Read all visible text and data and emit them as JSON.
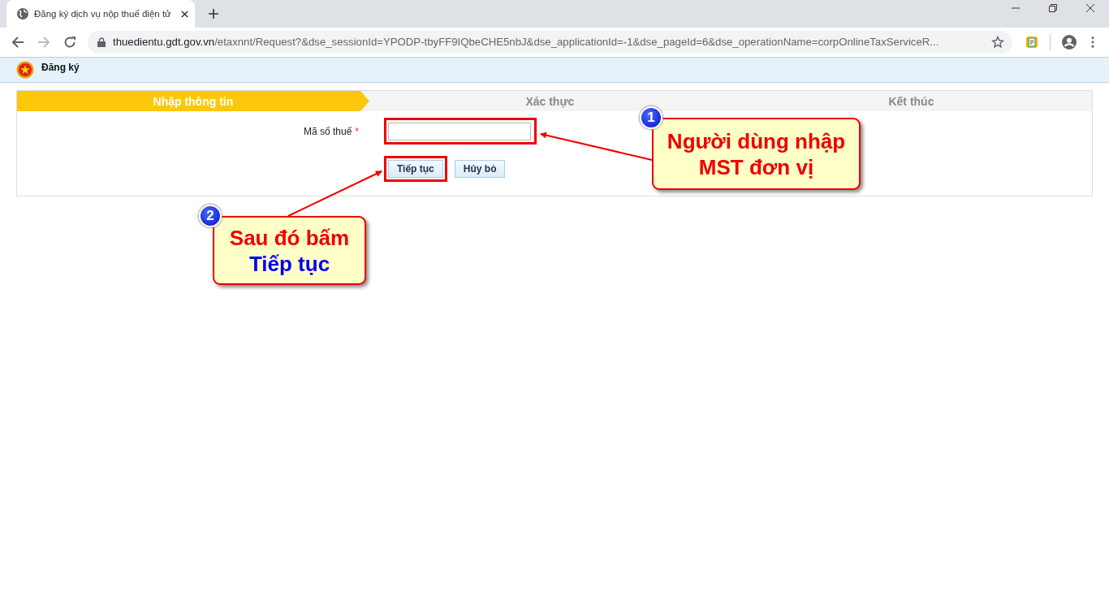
{
  "browser": {
    "tab": {
      "title": "Đăng ký dịch vụ nộp thuế điện tử",
      "selected": true
    },
    "url": {
      "host": "thuedientu.gdt.gov.vn",
      "path": "/etaxnnt/Request?&dse_sessionId=YPODP-tbyFF9IQbeCHE5nbJ&dse_applicationId=-1&dse_pageId=6&dse_operationName=corpOnlineTaxServiceR..."
    }
  },
  "header": {
    "title": "Đăng ký"
  },
  "steps": [
    {
      "label": "Nhập thông tin",
      "selected": true
    },
    {
      "label": "Xác thực",
      "selected": false
    },
    {
      "label": "Kết thúc",
      "selected": false
    }
  ],
  "form": {
    "field": {
      "label": "Mã số thuế",
      "required_mark": "*"
    },
    "buttons": [
      "Tiếp tục",
      "Hủy bỏ"
    ]
  },
  "callouts": [
    {
      "number": "1",
      "lines": [
        {
          "text": "Người dùng nhập",
          "color": "#ee0000"
        },
        {
          "text": "MST đơn vị",
          "color": "#ee0000"
        }
      ]
    },
    {
      "number": "2",
      "lines": [
        {
          "text": "Sau đó bấm",
          "color": "#ee0000"
        },
        {
          "text": "Tiếp tục",
          "color": "#0000ee"
        }
      ]
    }
  ]
}
